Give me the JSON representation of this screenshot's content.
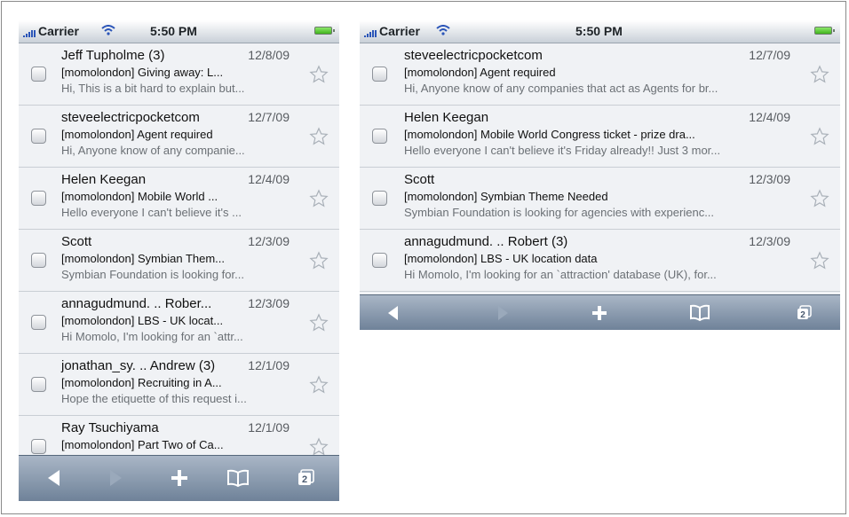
{
  "left_screen": {
    "status": {
      "carrier": "Carrier",
      "time": "5:50 PM"
    },
    "messages": [
      {
        "sender": "Jeff Tupholme (3)",
        "date": "12/8/09",
        "subject": "[momolondon] Giving away: L...",
        "preview": "Hi, This is a bit hard to explain but..."
      },
      {
        "sender": "steveelectricpocketcom",
        "date": "12/7/09",
        "subject": "[momolondon] Agent required",
        "preview": "Hi, Anyone know of any companie..."
      },
      {
        "sender": "Helen Keegan",
        "date": "12/4/09",
        "subject": "[momolondon] Mobile World ...",
        "preview": "Hello everyone I can't believe it's ..."
      },
      {
        "sender": "Scott",
        "date": "12/3/09",
        "subject": "[momolondon] Symbian Them...",
        "preview": "Symbian Foundation is looking for..."
      },
      {
        "sender": "annagudmund. .. Rober...",
        "date": "12/3/09",
        "subject": "[momolondon] LBS - UK locat...",
        "preview": "Hi Momolo, I'm looking for an `attr..."
      },
      {
        "sender": "jonathan_sy. .. Andrew (3)",
        "date": "12/1/09",
        "subject": "[momolondon] Recruiting in A...",
        "preview": "Hope the etiquette of this request i..."
      },
      {
        "sender": "Ray Tsuchiyama",
        "date": "12/1/09",
        "subject": "[momolondon] Part Two of Ca...",
        "preview": ""
      }
    ],
    "toolbar": {
      "tabs_count": "2"
    }
  },
  "right_screen": {
    "status": {
      "carrier": "Carrier",
      "time": "5:50 PM"
    },
    "messages": [
      {
        "sender": "steveelectricpocketcom",
        "date": "12/7/09",
        "subject": "[momolondon] Agent required",
        "preview": "Hi, Anyone know of any companies that act as Agents for br..."
      },
      {
        "sender": "Helen Keegan",
        "date": "12/4/09",
        "subject": "[momolondon] Mobile World Congress ticket - prize dra...",
        "preview": "Hello everyone I can't believe it's Friday already!! Just 3 mor..."
      },
      {
        "sender": "Scott",
        "date": "12/3/09",
        "subject": "[momolondon] Symbian Theme Needed",
        "preview": "Symbian Foundation is looking for agencies with experienc..."
      },
      {
        "sender": "annagudmund. .. Robert (3)",
        "date": "12/3/09",
        "subject": "[momolondon] LBS - UK location data",
        "preview": "Hi Momolo, I'm looking for an `attraction' database (UK), for..."
      }
    ],
    "toolbar": {
      "tabs_count": "2"
    }
  },
  "icons": {
    "back": "back-arrow-icon",
    "forward": "forward-arrow-icon",
    "add": "plus-icon",
    "bookmarks": "book-icon",
    "pages": "pages-icon",
    "signal": "signal-bars-icon",
    "wifi": "wifi-icon",
    "battery": "battery-icon",
    "star": "star-icon"
  },
  "colors": {
    "signal": "#2b55b8",
    "battery": "#41b31d",
    "toolbar": "#7f91a7",
    "list_background": "#f0f2f5"
  }
}
